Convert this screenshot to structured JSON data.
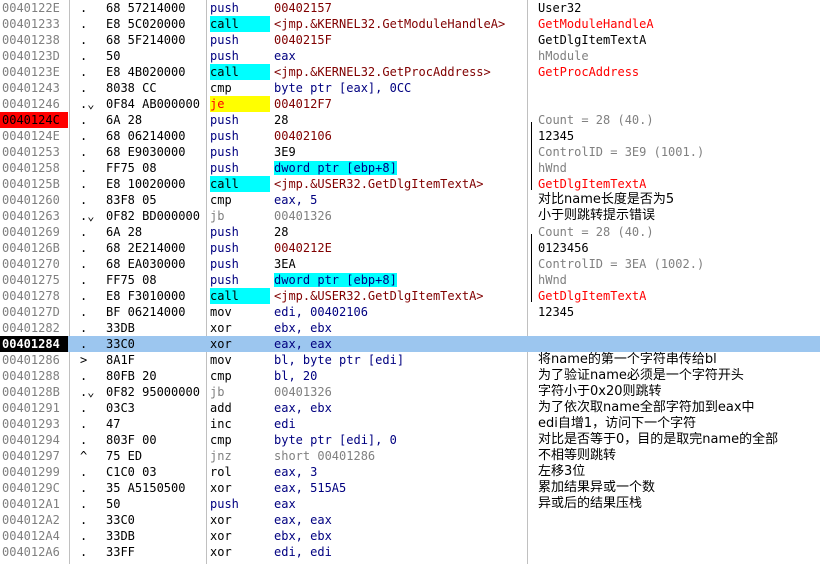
{
  "rows": [
    {
      "addr": "0040122E",
      "mark": ".",
      "bytes": "68 57214000",
      "mnem": "push",
      "mnem_style": "push",
      "ops": "00402157",
      "ops_style": "addr",
      "comment": "User32",
      "comment_style": "black"
    },
    {
      "addr": "00401233",
      "mark": ".",
      "bytes": "E8 5C020000",
      "mnem": "call",
      "mnem_style": "call",
      "ops": "<jmp.&KERNEL32.GetModuleHandleA>",
      "ops_style": "imp",
      "comment": "GetModuleHandleA",
      "comment_style": "red"
    },
    {
      "addr": "00401238",
      "mark": ".",
      "bytes": "68 5F214000",
      "mnem": "push",
      "mnem_style": "push",
      "ops": "0040215F",
      "ops_style": "addr",
      "comment": "GetDlgItemTextA",
      "comment_style": "black"
    },
    {
      "addr": "0040123D",
      "mark": ".",
      "bytes": "50",
      "mnem": "push",
      "mnem_style": "push",
      "ops": "eax",
      "ops_style": "navy",
      "comment": "hModule",
      "comment_style": "gray"
    },
    {
      "addr": "0040123E",
      "mark": ".",
      "bytes": "E8 4B020000",
      "mnem": "call",
      "mnem_style": "call",
      "ops": "<jmp.&KERNEL32.GetProcAddress>",
      "ops_style": "imp",
      "comment": "GetProcAddress",
      "comment_style": "red"
    },
    {
      "addr": "00401243",
      "mark": ".",
      "bytes": "8038 CC",
      "mnem": "cmp",
      "mnem_style": "plain",
      "ops": "byte ptr [eax], 0CC",
      "ops_style": "navy",
      "comment": "",
      "comment_style": "black"
    },
    {
      "addr": "00401246",
      "mark": ".⌄",
      "bytes": "0F84 AB000000",
      "mnem": "je",
      "mnem_style": "jcc",
      "ops": "004012F7",
      "ops_style": "addr",
      "comment": "",
      "comment_style": "black"
    },
    {
      "addr": "0040124C",
      "mark": ".",
      "bytes": "6A 28",
      "mnem": "push",
      "mnem_style": "push",
      "ops": "28",
      "ops_style": "num",
      "comment": "Count = 28 (40.)",
      "comment_style": "gray"
    },
    {
      "addr": "0040124E",
      "mark": ".",
      "bytes": "68 06214000",
      "mnem": "push",
      "mnem_style": "push",
      "ops": "00402106",
      "ops_style": "addr",
      "comment": "12345",
      "comment_style": "black"
    },
    {
      "addr": "00401253",
      "mark": ".",
      "bytes": "68 E9030000",
      "mnem": "push",
      "mnem_style": "push",
      "ops": "3E9",
      "ops_style": "num",
      "comment": "ControlID = 3E9 (1001.)",
      "comment_style": "gray"
    },
    {
      "addr": "00401258",
      "mark": ".",
      "bytes": "FF75 08",
      "mnem": "push",
      "mnem_style": "push",
      "ops": "dword ptr [ebp+8]",
      "ops_style": "cyan",
      "comment": "hWnd",
      "comment_style": "gray"
    },
    {
      "addr": "0040125B",
      "mark": ".",
      "bytes": "E8 10020000",
      "mnem": "call",
      "mnem_style": "call",
      "ops": "<jmp.&USER32.GetDlgItemTextA>",
      "ops_style": "imp",
      "comment": "GetDlgItemTextA",
      "comment_style": "red"
    },
    {
      "addr": "00401260",
      "mark": ".",
      "bytes": "83F8 05",
      "mnem": "cmp",
      "mnem_style": "plain",
      "ops": "eax, 5",
      "ops_style": "navy",
      "comment": "对比name长度是否为5",
      "comment_style": "zh"
    },
    {
      "addr": "00401263",
      "mark": ".⌄",
      "bytes": "0F82 BD000000",
      "mnem": "jb",
      "mnem_style": "jgray",
      "ops": "00401326",
      "ops_style": "gray",
      "comment": "小于则跳转提示错误",
      "comment_style": "zh"
    },
    {
      "addr": "00401269",
      "mark": ".",
      "bytes": "6A 28",
      "mnem": "push",
      "mnem_style": "push",
      "ops": "28",
      "ops_style": "num",
      "comment": "Count = 28 (40.)",
      "comment_style": "gray"
    },
    {
      "addr": "0040126B",
      "mark": ".",
      "bytes": "68 2E214000",
      "mnem": "push",
      "mnem_style": "push",
      "ops": "0040212E",
      "ops_style": "addr",
      "comment": "0123456",
      "comment_style": "black"
    },
    {
      "addr": "00401270",
      "mark": ".",
      "bytes": "68 EA030000",
      "mnem": "push",
      "mnem_style": "push",
      "ops": "3EA",
      "ops_style": "num",
      "comment": "ControlID = 3EA (1002.)",
      "comment_style": "gray"
    },
    {
      "addr": "00401275",
      "mark": ".",
      "bytes": "FF75 08",
      "mnem": "push",
      "mnem_style": "push",
      "ops": "dword ptr [ebp+8]",
      "ops_style": "cyan",
      "comment": "hWnd",
      "comment_style": "gray"
    },
    {
      "addr": "00401278",
      "mark": ".",
      "bytes": "E8 F3010000",
      "mnem": "call",
      "mnem_style": "call",
      "ops": "<jmp.&USER32.GetDlgItemTextA>",
      "ops_style": "imp",
      "comment": "GetDlgItemTextA",
      "comment_style": "red"
    },
    {
      "addr": "0040127D",
      "mark": ".",
      "bytes": "BF 06214000",
      "mnem": "mov",
      "mnem_style": "plain",
      "ops": "edi, 00402106",
      "ops_style": "navy",
      "comment": "12345",
      "comment_style": "black"
    },
    {
      "addr": "00401282",
      "mark": ".",
      "bytes": "33DB",
      "mnem": "xor",
      "mnem_style": "plain",
      "ops": "ebx, ebx",
      "ops_style": "navy",
      "comment": "",
      "comment_style": "black"
    },
    {
      "addr": "00401284",
      "mark": ".",
      "bytes": "33C0",
      "mnem": "xor",
      "mnem_style": "plain",
      "ops": "eax, eax",
      "ops_style": "navy",
      "comment": "",
      "comment_style": "black"
    },
    {
      "addr": "00401286",
      "mark": ">",
      "bytes": "8A1F",
      "mnem": "mov",
      "mnem_style": "plain",
      "ops": "bl, byte ptr [edi]",
      "ops_style": "navy",
      "comment": "将name的第一个字符串传给bl",
      "comment_style": "zh"
    },
    {
      "addr": "00401288",
      "mark": ".",
      "bytes": "80FB 20",
      "mnem": "cmp",
      "mnem_style": "plain",
      "ops": "bl, 20",
      "ops_style": "navy",
      "comment": "为了验证name必须是一个字符开头",
      "comment_style": "zh"
    },
    {
      "addr": "0040128B",
      "mark": ".⌄",
      "bytes": "0F82 95000000",
      "mnem": "jb",
      "mnem_style": "jgray",
      "ops": "00401326",
      "ops_style": "gray",
      "comment": "字符小于0x20则跳转",
      "comment_style": "zh"
    },
    {
      "addr": "00401291",
      "mark": ".",
      "bytes": "03C3",
      "mnem": "add",
      "mnem_style": "plain",
      "ops": "eax, ebx",
      "ops_style": "navy",
      "comment": "为了依次取name全部字符加到eax中",
      "comment_style": "zh"
    },
    {
      "addr": "00401293",
      "mark": ".",
      "bytes": "47",
      "mnem": "inc",
      "mnem_style": "plain",
      "ops": "edi",
      "ops_style": "navy",
      "comment": "edi自增1，访问下一个字符",
      "comment_style": "zh"
    },
    {
      "addr": "00401294",
      "mark": ".",
      "bytes": "803F 00",
      "mnem": "cmp",
      "mnem_style": "plain",
      "ops": "byte ptr [edi], 0",
      "ops_style": "navy",
      "comment": "对比是否等于0，目的是取完name的全部",
      "comment_style": "zh"
    },
    {
      "addr": "00401297",
      "mark": "^",
      "bytes": "75 ED",
      "mnem": "jnz",
      "mnem_style": "jgray",
      "ops": "short 00401286",
      "ops_style": "gray",
      "comment": "不相等则跳转",
      "comment_style": "zh"
    },
    {
      "addr": "00401299",
      "mark": ".",
      "bytes": "C1C0 03",
      "mnem": "rol",
      "mnem_style": "plain",
      "ops": "eax, 3",
      "ops_style": "navy",
      "comment": "左移3位",
      "comment_style": "zh"
    },
    {
      "addr": "0040129C",
      "mark": ".",
      "bytes": "35 A5150500",
      "mnem": "xor",
      "mnem_style": "plain",
      "ops": "eax, 515A5",
      "ops_style": "navy",
      "comment": "累加结果异或一个数",
      "comment_style": "zh"
    },
    {
      "addr": "004012A1",
      "mark": ".",
      "bytes": "50",
      "mnem": "push",
      "mnem_style": "push",
      "ops": "eax",
      "ops_style": "navy",
      "comment": "异或后的结果压栈",
      "comment_style": "zh"
    },
    {
      "addr": "004012A2",
      "mark": ".",
      "bytes": "33C0",
      "mnem": "xor",
      "mnem_style": "plain",
      "ops": "eax, eax",
      "ops_style": "navy",
      "comment": "",
      "comment_style": "black"
    },
    {
      "addr": "004012A4",
      "mark": ".",
      "bytes": "33DB",
      "mnem": "xor",
      "mnem_style": "plain",
      "ops": "ebx, ebx",
      "ops_style": "navy",
      "comment": "",
      "comment_style": "black"
    },
    {
      "addr": "004012A6",
      "mark": ".",
      "bytes": "33FF",
      "mnem": "xor",
      "mnem_style": "plain",
      "ops": "edi, edi",
      "ops_style": "navy",
      "comment": "",
      "comment_style": "black"
    }
  ],
  "breakpoint_row": 7,
  "current_row": 21,
  "selected_row": 21,
  "colors": {
    "breakpoint": "#ff0000",
    "selection": "#9cc6ef",
    "call_highlight": "#00ffff",
    "jump_highlight": "#ffff00",
    "api_name": "#ff0000"
  }
}
